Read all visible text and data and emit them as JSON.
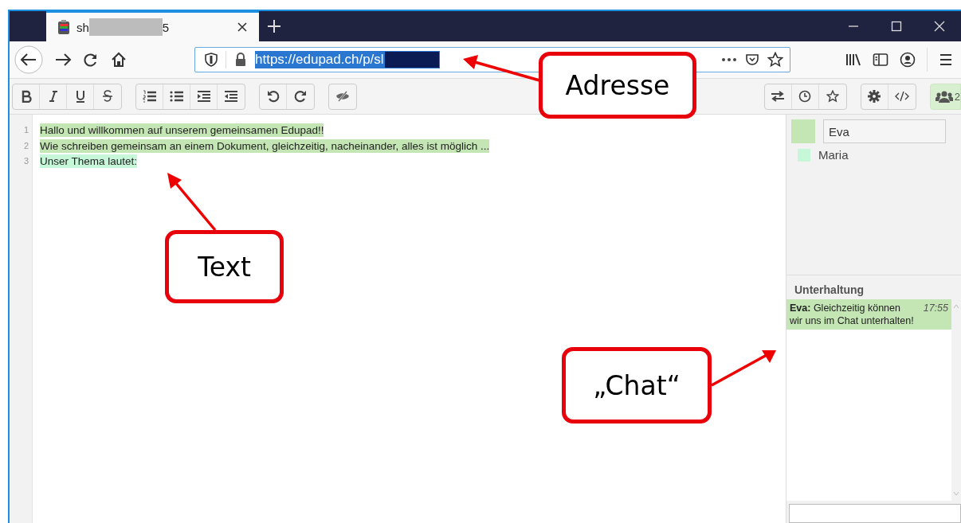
{
  "browser": {
    "tab": {
      "title_start": "sh",
      "title_end": "5"
    },
    "url": "https://edupad.ch/p/sl"
  },
  "toolbar": {
    "users_count": "2"
  },
  "editor": {
    "lines": [
      {
        "number": "1",
        "text": "Hallo und willkommen auf unserem gemeinsamen Edupad!!",
        "color": "#c4e6b4"
      },
      {
        "number": "2",
        "text": "Wie schreiben gemeinsam an einem Dokument, gleichzeitig, nacheinander, alles ist möglich ...",
        "color": "#c4e6b4"
      },
      {
        "number": "3",
        "text": "Unser Thema lautet:",
        "color": "#c6f7d9"
      }
    ]
  },
  "users": [
    {
      "name": "Eva",
      "color": "#c4e6b4",
      "kind": "self"
    },
    {
      "name": "Maria",
      "color": "#c6f7d9",
      "kind": "other"
    }
  ],
  "chat": {
    "title": "Unterhaltung",
    "messages": [
      {
        "author": "Eva:",
        "text": "Gleichzeitig können wir uns im Chat unterhalten!",
        "time": "17:55",
        "color": "#c4e6b4"
      }
    ]
  },
  "callouts": [
    {
      "label": "Adresse"
    },
    {
      "label": "Text"
    },
    {
      "label": "„Chat“"
    }
  ]
}
